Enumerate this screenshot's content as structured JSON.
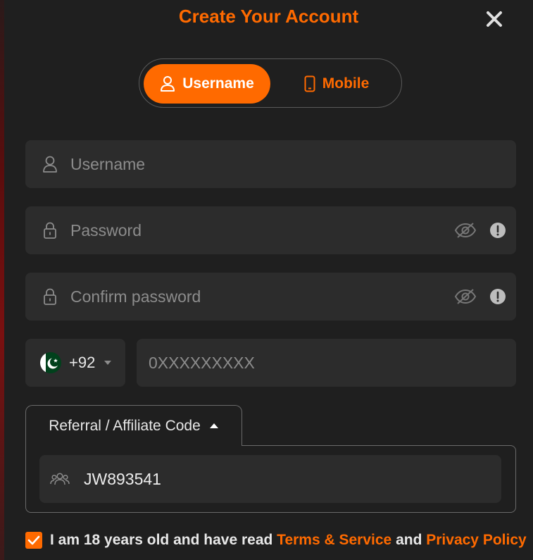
{
  "modal": {
    "title": "Create Your Account",
    "close_icon": "close-icon"
  },
  "tabs": [
    {
      "label": "Username",
      "icon": "user-icon",
      "active": true
    },
    {
      "label": "Mobile",
      "icon": "mobile-phone-icon",
      "active": false
    }
  ],
  "form": {
    "username": {
      "placeholder": "Username",
      "value": "",
      "icon": "user-icon"
    },
    "password": {
      "placeholder": "Password",
      "value": "",
      "icon": "lock-icon",
      "toggle_icon": "eye-slash-icon",
      "info_icon": "alert-circle-icon"
    },
    "confirm_password": {
      "placeholder": "Confirm password",
      "value": "",
      "icon": "lock-icon",
      "toggle_icon": "eye-slash-icon",
      "info_icon": "alert-circle-icon"
    },
    "phone": {
      "country_code": "+92",
      "flag": "pakistan-flag-icon",
      "placeholder": "0XXXXXXXXX",
      "value": ""
    },
    "referral": {
      "label": "Referral / Affiliate Code",
      "value": "JW893541",
      "icon": "users-icon",
      "expanded": true
    }
  },
  "terms": {
    "checked": true,
    "text_prefix": "I am 18 years old and have read",
    "terms_link": "Terms & Service",
    "connector": "and",
    "privacy_link": "Privacy Policy"
  },
  "colors": {
    "accent": "#ff6a00",
    "background": "#1f1f1f",
    "field": "#2c2c2c",
    "placeholder": "#8c8c8c"
  }
}
